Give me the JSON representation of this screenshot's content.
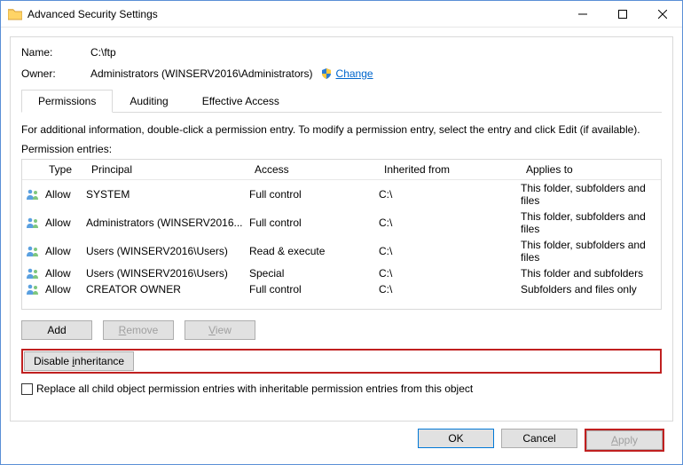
{
  "window": {
    "title": "Advanced Security Settings"
  },
  "titlebar_buttons": {
    "min": "Minimize",
    "max": "Maximize",
    "close": "Close"
  },
  "info": {
    "name_label": "Name:",
    "name_value": "C:\\ftp",
    "owner_label": "Owner:",
    "owner_value": "Administrators (WINSERV2016\\Administrators)",
    "change_link": "Change"
  },
  "tabs": {
    "permissions": "Permissions",
    "auditing": "Auditing",
    "effective": "Effective Access"
  },
  "hint": "For additional information, double-click a permission entry. To modify a permission entry, select the entry and click Edit (if available).",
  "entries_label": "Permission entries:",
  "columns": {
    "type": "Type",
    "principal": "Principal",
    "access": "Access",
    "inherited": "Inherited from",
    "applies": "Applies to"
  },
  "rows": [
    {
      "type": "Allow",
      "principal": "SYSTEM",
      "access": "Full control",
      "inherited": "C:\\",
      "applies": "This folder, subfolders and files"
    },
    {
      "type": "Allow",
      "principal": "Administrators (WINSERV2016...",
      "access": "Full control",
      "inherited": "C:\\",
      "applies": "This folder, subfolders and files"
    },
    {
      "type": "Allow",
      "principal": "Users (WINSERV2016\\Users)",
      "access": "Read & execute",
      "inherited": "C:\\",
      "applies": "This folder, subfolders and files"
    },
    {
      "type": "Allow",
      "principal": "Users (WINSERV2016\\Users)",
      "access": "Special",
      "inherited": "C:\\",
      "applies": "This folder and subfolders"
    },
    {
      "type": "Allow",
      "principal": "CREATOR OWNER",
      "access": "Full control",
      "inherited": "C:\\",
      "applies": "Subfolders and files only"
    }
  ],
  "buttons": {
    "add": "Add",
    "remove": "Remove",
    "view": "View",
    "disable_inh": "Disable inheritance",
    "ok": "OK",
    "cancel": "Cancel",
    "apply": "Apply"
  },
  "checkbox_label": "Replace all child object permission entries with inheritable permission entries from this object"
}
